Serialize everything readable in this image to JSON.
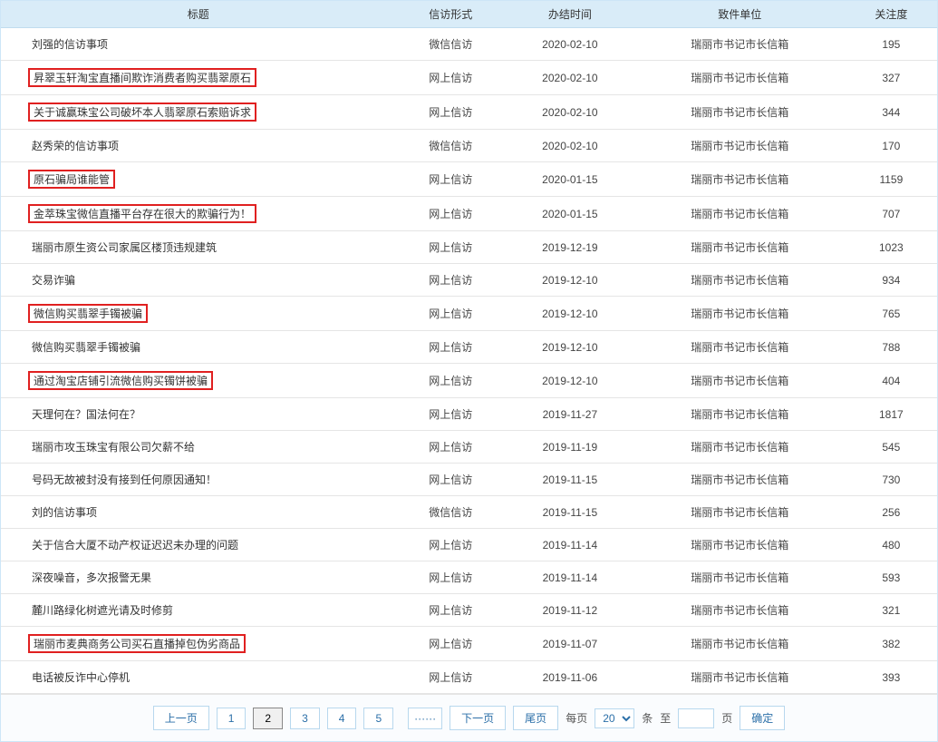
{
  "headers": {
    "title": "标题",
    "method": "信访形式",
    "date": "办结时间",
    "unit": "致件单位",
    "views": "关注度"
  },
  "rows": [
    {
      "title": "刘强的信访事项",
      "highlighted": false,
      "method": "微信信访",
      "date": "2020-02-10",
      "unit": "瑞丽市书记市长信箱",
      "views": "195"
    },
    {
      "title": "昇翠玉轩淘宝直播间欺诈消费者购买翡翠原石",
      "highlighted": true,
      "method": "网上信访",
      "date": "2020-02-10",
      "unit": "瑞丽市书记市长信箱",
      "views": "327"
    },
    {
      "title": "关于诚赢珠宝公司破坏本人翡翠原石索赔诉求",
      "highlighted": true,
      "method": "网上信访",
      "date": "2020-02-10",
      "unit": "瑞丽市书记市长信箱",
      "views": "344"
    },
    {
      "title": "赵秀荣的信访事项",
      "highlighted": false,
      "method": "微信信访",
      "date": "2020-02-10",
      "unit": "瑞丽市书记市长信箱",
      "views": "170"
    },
    {
      "title": "原石骗局谁能管",
      "highlighted": true,
      "method": "网上信访",
      "date": "2020-01-15",
      "unit": "瑞丽市书记市长信箱",
      "views": "1159"
    },
    {
      "title": "金萃珠宝微信直播平台存在很大的欺骗行为！",
      "highlighted": true,
      "method": "网上信访",
      "date": "2020-01-15",
      "unit": "瑞丽市书记市长信箱",
      "views": "707"
    },
    {
      "title": "瑞丽市原生资公司家属区楼顶违规建筑",
      "highlighted": false,
      "method": "网上信访",
      "date": "2019-12-19",
      "unit": "瑞丽市书记市长信箱",
      "views": "1023"
    },
    {
      "title": "交易诈骗",
      "highlighted": false,
      "method": "网上信访",
      "date": "2019-12-10",
      "unit": "瑞丽市书记市长信箱",
      "views": "934"
    },
    {
      "title": "微信购买翡翠手镯被骗",
      "highlighted": true,
      "method": "网上信访",
      "date": "2019-12-10",
      "unit": "瑞丽市书记市长信箱",
      "views": "765"
    },
    {
      "title": "微信购买翡翠手镯被骗",
      "highlighted": false,
      "method": "网上信访",
      "date": "2019-12-10",
      "unit": "瑞丽市书记市长信箱",
      "views": "788"
    },
    {
      "title": "通过淘宝店铺引流微信购买镯饼被骗",
      "highlighted": true,
      "method": "网上信访",
      "date": "2019-12-10",
      "unit": "瑞丽市书记市长信箱",
      "views": "404"
    },
    {
      "title": "天理何在？国法何在？",
      "highlighted": false,
      "method": "网上信访",
      "date": "2019-11-27",
      "unit": "瑞丽市书记市长信箱",
      "views": "1817"
    },
    {
      "title": "瑞丽市攻玉珠宝有限公司欠薪不给",
      "highlighted": false,
      "method": "网上信访",
      "date": "2019-11-19",
      "unit": "瑞丽市书记市长信箱",
      "views": "545"
    },
    {
      "title": "号码无故被封没有接到任何原因通知！",
      "highlighted": false,
      "method": "网上信访",
      "date": "2019-11-15",
      "unit": "瑞丽市书记市长信箱",
      "views": "730"
    },
    {
      "title": "刘的信访事项",
      "highlighted": false,
      "method": "微信信访",
      "date": "2019-11-15",
      "unit": "瑞丽市书记市长信箱",
      "views": "256"
    },
    {
      "title": "关于信合大厦不动产权证迟迟未办理的问题",
      "highlighted": false,
      "method": "网上信访",
      "date": "2019-11-14",
      "unit": "瑞丽市书记市长信箱",
      "views": "480"
    },
    {
      "title": "深夜噪音，多次报警无果",
      "highlighted": false,
      "method": "网上信访",
      "date": "2019-11-14",
      "unit": "瑞丽市书记市长信箱",
      "views": "593"
    },
    {
      "title": "麓川路绿化树遮光请及时修剪",
      "highlighted": false,
      "method": "网上信访",
      "date": "2019-11-12",
      "unit": "瑞丽市书记市长信箱",
      "views": "321"
    },
    {
      "title": "瑞丽市麦典商务公司买石直播掉包伪劣商品",
      "highlighted": true,
      "method": "网上信访",
      "date": "2019-11-07",
      "unit": "瑞丽市书记市长信箱",
      "views": "382"
    },
    {
      "title": "电话被反诈中心停机",
      "highlighted": false,
      "method": "网上信访",
      "date": "2019-11-06",
      "unit": "瑞丽市书记市长信箱",
      "views": "393"
    }
  ],
  "pagination": {
    "prev": "上一页",
    "next": "下一页",
    "last": "尾页",
    "per_page_pre": "每页",
    "per_page_post": "条",
    "goto": "至",
    "page_unit": "页",
    "confirm": "确定",
    "dots": "······",
    "pages": [
      "1",
      "2",
      "3",
      "4",
      "5"
    ],
    "current": "2",
    "per_page_value": "20"
  }
}
